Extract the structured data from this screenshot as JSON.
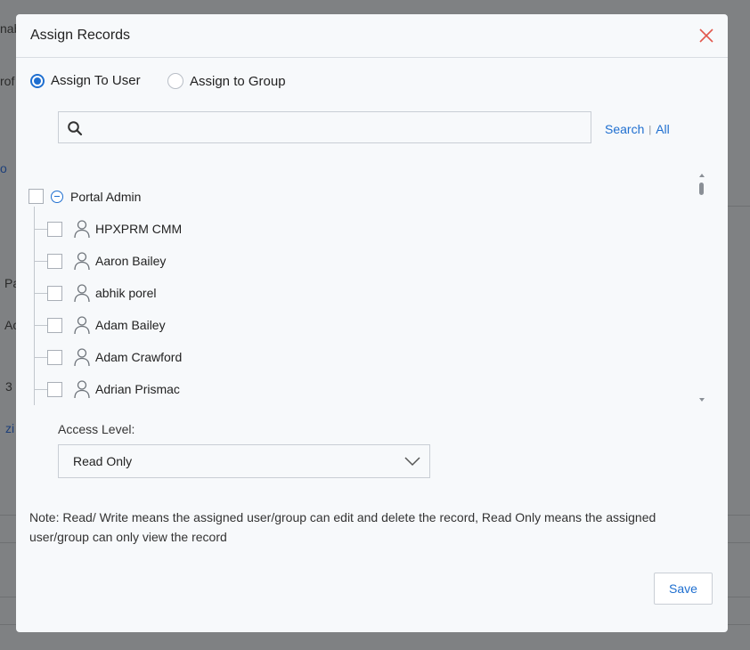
{
  "background": {
    "fragments": [
      "nab",
      "rof",
      "o",
      "Pa",
      "Ac",
      "3",
      "zi"
    ]
  },
  "modal": {
    "title": "Assign Records",
    "close_icon": "close-icon",
    "assign_options": {
      "user_label": "Assign To User",
      "group_label": "Assign to Group",
      "selected": "user"
    },
    "search": {
      "placeholder": "",
      "value": "",
      "search_link": "Search",
      "separator": "|",
      "all_link": "All"
    },
    "tree": {
      "root_label": "Portal Admin",
      "users": [
        {
          "name": "HPXPRM CMM"
        },
        {
          "name": "Aaron Bailey"
        },
        {
          "name": "abhik porel"
        },
        {
          "name": "Adam Bailey"
        },
        {
          "name": "Adam Crawford"
        },
        {
          "name": "Adrian Prismac"
        }
      ]
    },
    "access_level": {
      "label": "Access Level:",
      "selected": "Read Only"
    },
    "note": "Note: Read/ Write means the assigned user/group can edit and delete the record, Read Only means the assigned user/group can only view the record",
    "save_label": "Save"
  },
  "colors": {
    "accent": "#1f6fd0",
    "close": "#e2574c",
    "overlay": "#7f8183",
    "modal_bg": "#f7f9fb"
  }
}
